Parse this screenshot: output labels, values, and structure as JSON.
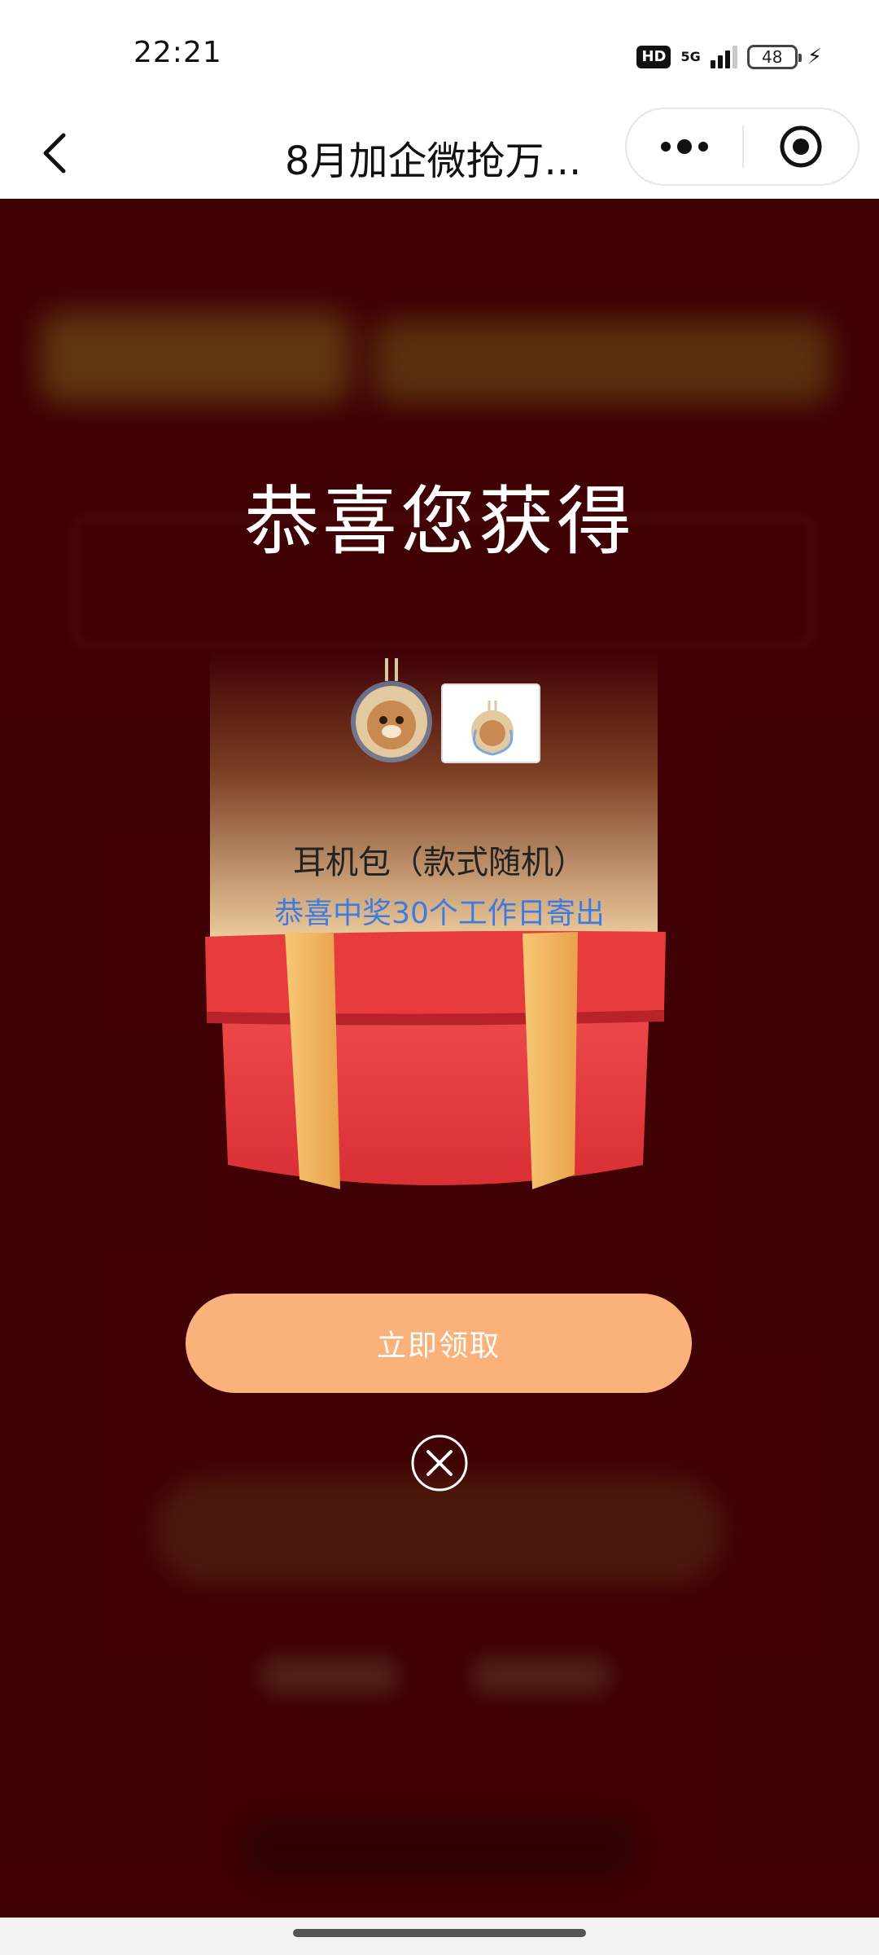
{
  "status_bar": {
    "time": "22:21",
    "hd": "HD",
    "network": "5G",
    "battery": "48"
  },
  "nav": {
    "title": "8月加企微抢万..."
  },
  "modal": {
    "title": "恭喜您获得",
    "prize_name": "耳机包（款式随机）",
    "prize_note": "恭喜中奖30个工作日寄出",
    "claim_button": "立即领取"
  },
  "colors": {
    "page_bg": "#5a0308",
    "claim_button": "#fbb27a",
    "note_text": "#3d7be0",
    "gift_red": "#e63b3e",
    "ribbon_gold": "#f3b25b"
  },
  "icons": {
    "back": "chevron-left-icon",
    "more": "more-dots-icon",
    "mini_close": "target-icon",
    "close": "close-circle-icon"
  }
}
